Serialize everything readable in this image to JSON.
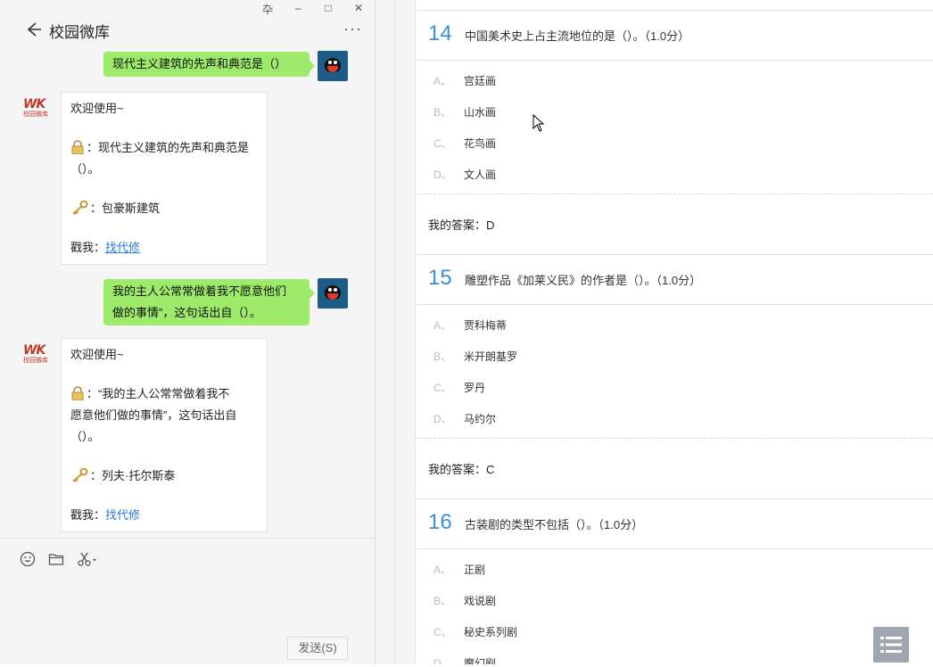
{
  "window": {
    "controls": [
      "卆",
      "–",
      "□",
      "✕"
    ]
  },
  "chat": {
    "title": "校园微库",
    "more": "···",
    "logo": {
      "line1": "WK",
      "line2": "校园微库"
    },
    "messages": [
      {
        "type": "sent",
        "text": "现代主义建筑的先声和典范是（）"
      },
      {
        "type": "bot",
        "greeting": "欢迎使用~",
        "question": "：现代主义建筑的先声和典范是（）。",
        "answer": "：包豪斯建筑",
        "footer_label": "戳我：",
        "footer_link": "找代修"
      },
      {
        "type": "sent",
        "line1": "我的主人公常常做着我不愿意他们",
        "line2": "做的事情”，这句话出自（）。"
      },
      {
        "type": "bot",
        "greeting": "欢迎使用~",
        "q_line1": "：“我的主人公常常做着我不",
        "q_line2": "愿意他们做的事情”，这句话出自",
        "q_line3": "（）。",
        "answer": "：列夫·托尔斯泰",
        "footer_label": "戳我：",
        "footer_link": "找代修"
      }
    ],
    "send_label": "发送(S)"
  },
  "quiz": {
    "questions": [
      {
        "num": "14",
        "text": "中国美术史上占主流地位的是（）。（1.0分）",
        "options": [
          {
            "letter": "A、",
            "text": "宫廷画"
          },
          {
            "letter": "B、",
            "text": "山水画"
          },
          {
            "letter": "C、",
            "text": "花鸟画"
          },
          {
            "letter": "D、",
            "text": "文人画"
          }
        ],
        "my_answer": "我的答案：D"
      },
      {
        "num": "15",
        "text": "雕塑作品《加莱义民》的作者是（）。（1.0分）",
        "options": [
          {
            "letter": "A、",
            "text": "贾科梅蒂"
          },
          {
            "letter": "B、",
            "text": "米开朗基罗"
          },
          {
            "letter": "C、",
            "text": "罗丹"
          },
          {
            "letter": "D、",
            "text": "马约尔"
          }
        ],
        "my_answer": "我的答案：C"
      },
      {
        "num": "16",
        "text": "古装剧的类型不包括（）。（1.0分）",
        "options": [
          {
            "letter": "A、",
            "text": "正剧"
          },
          {
            "letter": "B、",
            "text": "戏说剧"
          },
          {
            "letter": "C、",
            "text": "秘史系列剧"
          },
          {
            "letter": "D、",
            "text": "魔幻剧"
          }
        ]
      }
    ]
  },
  "colors": {
    "sent_bubble": "#9eea6a",
    "link": "#2a7ad6",
    "question_number": "#3a8fd9",
    "avatar_bg": "#1d5c86"
  },
  "icons": [
    "back-arrow-icon",
    "more-icon",
    "lock-icon",
    "key-icon",
    "emoji-icon",
    "folder-icon",
    "scissors-icon",
    "list-menu-icon"
  ]
}
